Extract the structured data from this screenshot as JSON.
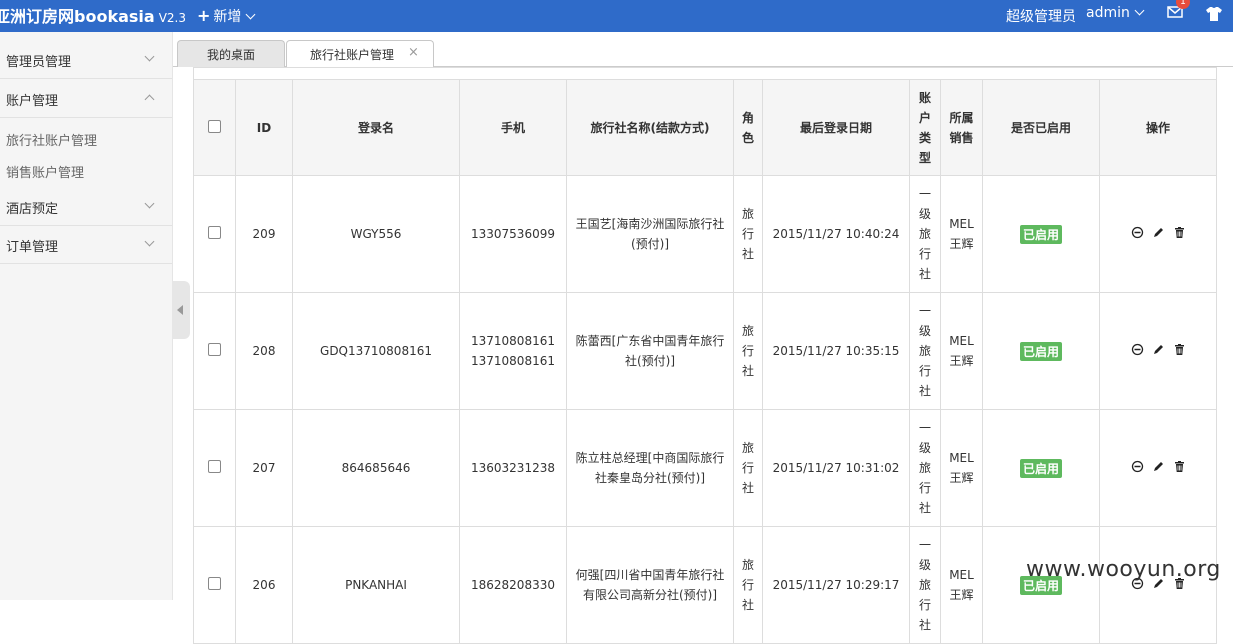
{
  "header": {
    "brand": "亚洲订房网bookasia",
    "version": "V2.3",
    "add_label": "新增",
    "role": "超级管理员",
    "user": "admin",
    "mail_badge": "1",
    "colors": {
      "bar": "#2f6bc9",
      "badge": "#e74c3c"
    }
  },
  "sidebar": {
    "items": [
      {
        "label": "管理员管理"
      },
      {
        "label": "账户管理"
      },
      {
        "label": "酒店预定"
      },
      {
        "label": "订单管理"
      }
    ],
    "sub_items": [
      {
        "label": "旅行社账户管理"
      },
      {
        "label": "销售账户管理"
      }
    ]
  },
  "tabs": [
    {
      "label": "我的桌面"
    },
    {
      "label": "旅行社账户管理"
    }
  ],
  "tab_close": "×",
  "table": {
    "columns": [
      "ID",
      "登录名",
      "手机",
      "旅行社名称(结款方式)",
      "角色",
      "最后登录日期",
      "账户类型",
      "所属销售",
      "是否已启用",
      "操作"
    ],
    "rows": [
      {
        "id": "209",
        "login": "WGY556",
        "phone1": "13307536099",
        "phone2": "",
        "agency1": "王国艺[海南沙洲国际旅行社",
        "agency2": "(预付)]",
        "role": "旅行社",
        "last_login": "2015/11/27 10:40:24",
        "type": "一级旅行社",
        "sales1": "MEL",
        "sales2": "王辉",
        "status": "已启用"
      },
      {
        "id": "208",
        "login": "GDQ13710808161",
        "phone1": "13710808161",
        "phone2": "13710808161",
        "agency1": "陈蕾西[广东省中国青年旅行",
        "agency2": "社(预付)]",
        "role": "旅行社",
        "last_login": "2015/11/27 10:35:15",
        "type": "一级旅行社",
        "sales1": "MEL",
        "sales2": "王辉",
        "status": "已启用"
      },
      {
        "id": "207",
        "login": "864685646",
        "phone1": "13603231238",
        "phone2": "",
        "agency1": "陈立柱总经理[中商国际旅行",
        "agency2": "社秦皇岛分社(预付)]",
        "role": "旅行社",
        "last_login": "2015/11/27 10:31:02",
        "type": "一级旅行社",
        "sales1": "MEL",
        "sales2": "王辉",
        "status": "已启用"
      },
      {
        "id": "206",
        "login": "PNKANHAI",
        "phone1": "18628208330",
        "phone2": "",
        "agency1": "何强[四川省中国青年旅行社",
        "agency2": "有限公司高新分社(预付)]",
        "role": "旅行社",
        "last_login": "2015/11/27 10:29:17",
        "type": "一级旅行社",
        "sales1": "MEL",
        "sales2": "王辉",
        "status": "已启用"
      }
    ],
    "status_color": "#5eb95e",
    "action_icons": [
      "disable-icon",
      "edit-icon",
      "trash-icon"
    ]
  },
  "watermark": "www.wooyun.org"
}
